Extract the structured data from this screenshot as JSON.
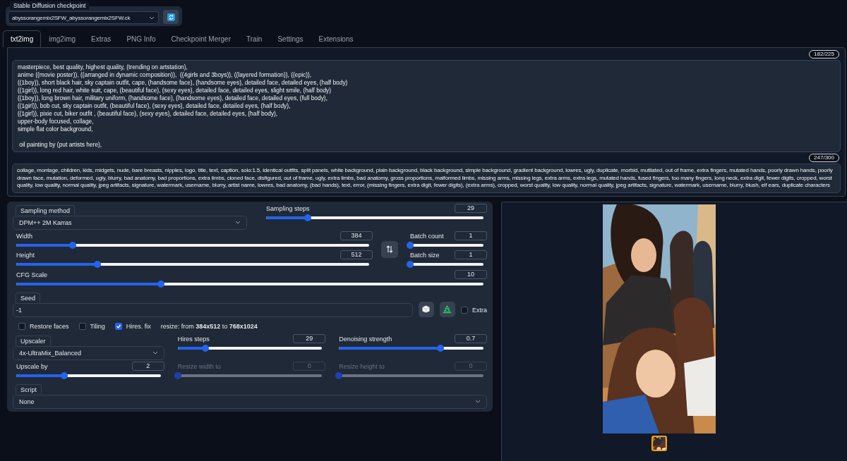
{
  "checkpoint": {
    "label": "Stable Diffusion checkpoint",
    "value": "abyssorangemix2SFW_abyssorangemix2SFW.ck"
  },
  "tabs": [
    {
      "label": "txt2img",
      "selected": true
    },
    {
      "label": "img2img",
      "selected": false
    },
    {
      "label": "Extras",
      "selected": false
    },
    {
      "label": "PNG Info",
      "selected": false
    },
    {
      "label": "Checkpoint Merger",
      "selected": false
    },
    {
      "label": "Train",
      "selected": false
    },
    {
      "label": "Settings",
      "selected": false
    },
    {
      "label": "Extensions",
      "selected": false
    }
  ],
  "prompt": {
    "counter": "182/225",
    "text": "masterpiece, best quality, highest quality, (trending on artstation),\nanime ((movie poster)), ((arranged in dynamic composition)),  ((4girls and 3boys)), ((layered formation)), ((epic)),\n((1boy)), short black hair, sky captain outfit, cape, (handsome face), (handsome eyes), detailed face, detailed eyes, (half body)\n((1girl)), long red hair, white suit, cape, (beautiful face), (sexy eyes), detailed face, detailed eyes, slight smile, (half body)\n((1boy)), long brown hair, military uniform, (handsome face), (handsome eyes), detailed face, detailed eyes, (full body),\n((1girl)), bob cut, sky captain outfit, (beautiful face), (sexy eyes), detailed face, detailed eyes, (half body),\n((1girl)), pixie cut, biker outfit , (beautiful face), (sexy eyes), detailed face, detailed eyes, (half body),\nupper-body focused, collage,\nsimple flat color background,\n\n oil painting by (put artists here),"
  },
  "negative_prompt": {
    "counter": "247/300",
    "text": "collage, montage, children, kids, midgets, nude, bare breasts, nipples, logo, title, text, caption, solo:1.5, identical outfits, split panels, white background, plain background, black background, simple background, gradient background, lowres, ugly, duplicate, morbid, mutilated, out of frame, extra fingers, mutated hands, poorly drawn hands, poorly drawn face, mutation, deformed, ugly, blurry, bad anatomy, bad proportions, extra limbs, cloned face, disfigured, out of frame, ugly, extra limbs, bad anatomy, gross proportions, malformed limbs, missing arms, missing legs, extra arms, extra legs, mutated hands, fused fingers, too many fingers, long neck, extra digit, fewer digits, cropped, worst quality, low quality, normal quality, jpeg artifacts, signature, watermark, username, blurry, artist name, lowres, bad anatomy, (bad hands), text, error, (missing fingers, extra digit, fewer digits), (extra arms), cropped, worst quality, low quality, normal quality, jpeg artifacts, signature, watermark, username, blurry, blush, elf ears, duplicate characters"
  },
  "sampling_method": {
    "label": "Sampling method",
    "value": "DPM++ 2M Karras"
  },
  "sampling_steps": {
    "label": "Sampling steps",
    "value": "29",
    "level": 0.19,
    "disabled": false
  },
  "width": {
    "label": "Width",
    "value": "384",
    "level": 0.16,
    "disabled": false
  },
  "height": {
    "label": "Height",
    "value": "512",
    "level": 0.23,
    "disabled": false
  },
  "batch_count": {
    "label": "Batch count",
    "value": "1",
    "level": 0,
    "disabled": false
  },
  "batch_size": {
    "label": "Batch size",
    "value": "1",
    "level": 0,
    "disabled": false
  },
  "cfg_scale": {
    "label": "CFG Scale",
    "value": "10",
    "level": 0.31,
    "disabled": false
  },
  "seed": {
    "label": "Seed",
    "value": "-1"
  },
  "extra": {
    "label": "Extra",
    "checked": false
  },
  "options": [
    {
      "label": "Restore faces",
      "checked": false
    },
    {
      "label": "Tiling",
      "checked": false
    },
    {
      "label": "Hires. fix",
      "checked": true
    }
  ],
  "hires_note": "resize: from **384x512** to **768x1024**",
  "upscaler": {
    "label": "Upscaler",
    "value": "4x-UltraMix_Balanced"
  },
  "hires_steps": {
    "label": "Hires steps",
    "value": "29",
    "level": 0.19,
    "disabled": false
  },
  "denoising_strength": {
    "label": "Denoising strength",
    "value": "0.7",
    "level": 0.7,
    "disabled": false
  },
  "upscale_by": {
    "label": "Upscale by",
    "value": "2",
    "level": 0.33,
    "disabled": false
  },
  "resize_width_to": {
    "label": "Resize width to",
    "value": "0",
    "level": 0,
    "disabled": true
  },
  "resize_height_to": {
    "label": "Resize height to",
    "value": "0",
    "level": 0,
    "disabled": true
  },
  "script": {
    "label": "Script",
    "value": "None"
  },
  "gallery": {
    "thumbnails": [
      {
        "selected": true
      }
    ]
  }
}
